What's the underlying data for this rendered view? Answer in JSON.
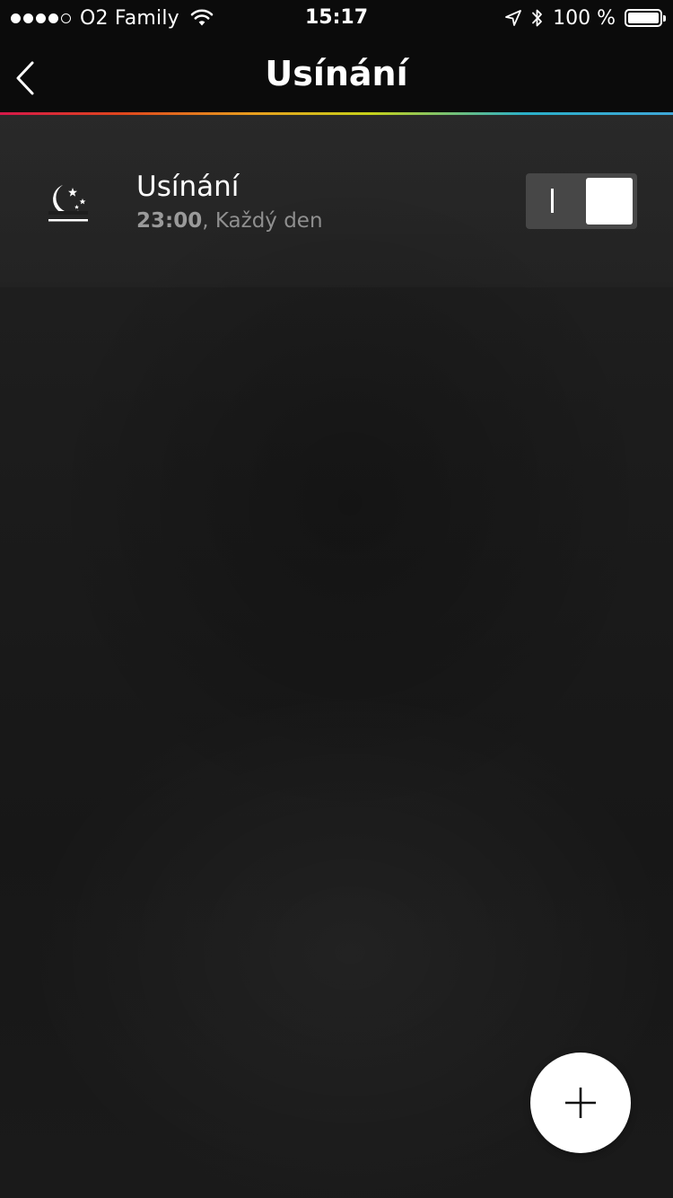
{
  "status_bar": {
    "carrier": "O2 Family",
    "time": "15:17",
    "battery": "100 %",
    "signal_bars_filled": 4,
    "signal_bars_total": 5
  },
  "nav": {
    "title": "Usínání",
    "back_icon": "chevron-left-icon"
  },
  "routines": [
    {
      "icon": "moon-stars-icon",
      "title": "Usínání",
      "time": "23:00",
      "separator": ", ",
      "repeat": "Každý den",
      "enabled": true
    }
  ],
  "fab": {
    "icon": "plus-icon"
  },
  "colors": {
    "background": "#1a1a1a",
    "bar": "#0b0b0b",
    "subtext": "#8f8f8f",
    "toggle_track": "#474747",
    "white": "#ffffff"
  }
}
